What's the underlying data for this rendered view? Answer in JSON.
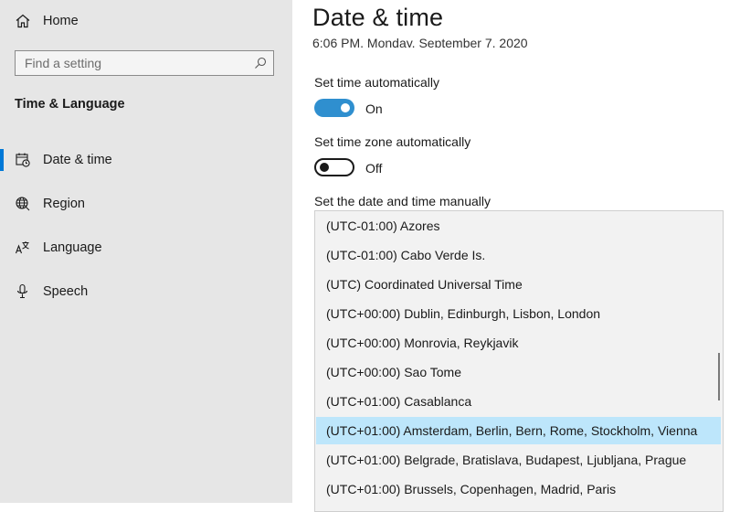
{
  "sidebar": {
    "home_label": "Home",
    "search_placeholder": "Find a setting",
    "section_title": "Time & Language",
    "items": [
      {
        "label": "Date & time",
        "icon": "calendar-clock-icon",
        "selected": true
      },
      {
        "label": "Region",
        "icon": "globe-icon",
        "selected": false
      },
      {
        "label": "Language",
        "icon": "language-icon",
        "selected": false
      },
      {
        "label": "Speech",
        "icon": "microphone-icon",
        "selected": false
      }
    ]
  },
  "main": {
    "title": "Date & time",
    "current_time": "6:06 PM, Monday, September 7, 2020",
    "set_time_auto": {
      "label": "Set time automatically",
      "state": "On",
      "on": true
    },
    "set_timezone_auto": {
      "label": "Set time zone automatically",
      "state": "Off",
      "on": false
    },
    "manual_label": "Set the date and time manually",
    "timezone_dropdown": {
      "options": [
        "(UTC-01:00) Azores",
        "(UTC-01:00) Cabo Verde Is.",
        "(UTC) Coordinated Universal Time",
        "(UTC+00:00) Dublin, Edinburgh, Lisbon, London",
        "(UTC+00:00) Monrovia, Reykjavik",
        "(UTC+00:00) Sao Tome",
        "(UTC+01:00) Casablanca",
        "(UTC+01:00) Amsterdam, Berlin, Bern, Rome, Stockholm, Vienna",
        "(UTC+01:00) Belgrade, Bratislava, Budapest, Ljubljana, Prague",
        "(UTC+01:00) Brussels, Copenhagen, Madrid, Paris"
      ],
      "highlighted": "(UTC+01:00) Amsterdam, Berlin, Bern, Rome, Stockholm, Vienna"
    }
  },
  "colors": {
    "sidebar_bg": "#e6e6e6",
    "accent": "#0078d7",
    "toggle_on": "#2f8fcf",
    "highlight": "#bde6fb",
    "dropdown_bg": "#f2f2f2"
  }
}
